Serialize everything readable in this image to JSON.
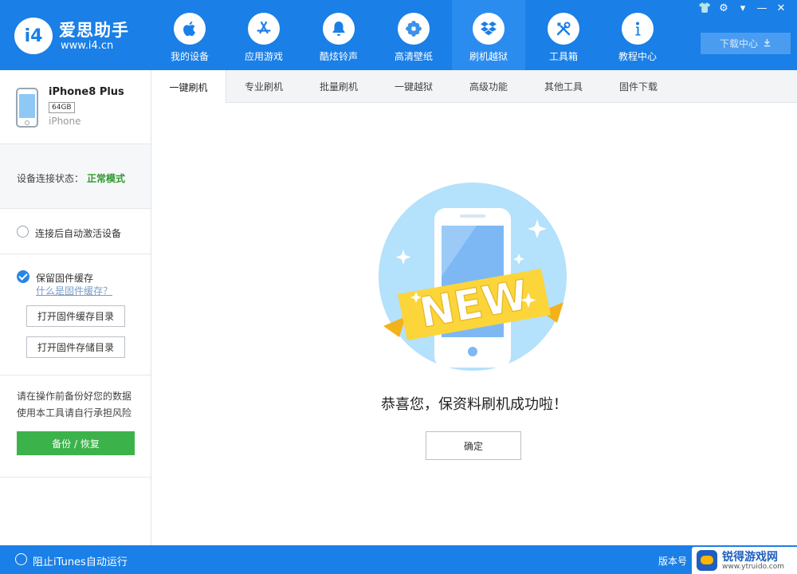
{
  "app": {
    "logo_badge": "i4",
    "name": "爱思助手",
    "url": "www.i4.cn"
  },
  "nav": [
    {
      "label": "我的设备",
      "icon": "apple-icon"
    },
    {
      "label": "应用游戏",
      "icon": "app-store-icon"
    },
    {
      "label": "酷炫铃声",
      "icon": "bell-icon"
    },
    {
      "label": "高清壁纸",
      "icon": "flower-icon"
    },
    {
      "label": "刷机越狱",
      "icon": "dropbox-icon",
      "active": true
    },
    {
      "label": "工具箱",
      "icon": "tools-icon"
    },
    {
      "label": "教程中心",
      "icon": "info-icon"
    }
  ],
  "window_controls": [
    "👕",
    "⚙",
    "▾",
    "—",
    "✕"
  ],
  "download_center": {
    "label": "下载中心",
    "icon": "download-icon"
  },
  "device": {
    "name": "iPhone8 Plus",
    "capacity": "64GB",
    "type": "iPhone"
  },
  "status": {
    "label": "设备连接状态：",
    "value": "正常模式",
    "value_color": "#2e9a2e"
  },
  "options": {
    "auto_activate": "连接后自动激活设备",
    "keep_cache": "保留固件缓存",
    "what_cache": "什么是固件缓存？",
    "open_cache_dir": "打开固件缓存目录",
    "open_storage_dir": "打开固件存储目录"
  },
  "backup": {
    "tip_line1": "请在操作前备份好您的数据",
    "tip_line2": "使用本工具请自行承担风险",
    "button": "备份 / 恢复"
  },
  "tabs": [
    {
      "label": "一键刷机",
      "active": true
    },
    {
      "label": "专业刷机"
    },
    {
      "label": "批量刷机"
    },
    {
      "label": "一键越狱"
    },
    {
      "label": "高级功能"
    },
    {
      "label": "其他工具"
    },
    {
      "label": "固件下载"
    }
  ],
  "main": {
    "banner_text": "NEW",
    "success_message": "恭喜您，保资料刷机成功啦！",
    "confirm_button": "确定"
  },
  "footer": {
    "itunes_label": "阻止iTunes自动运行",
    "version_label": "版本号"
  },
  "watermark": {
    "title": "锐得游戏网",
    "url": "www.ytruido.com"
  },
  "colors": {
    "header_blue": "#1a7fe6",
    "active_nav": "#2b8cf0",
    "success_green": "#3cb34a",
    "check_blue": "#2a86e6"
  }
}
